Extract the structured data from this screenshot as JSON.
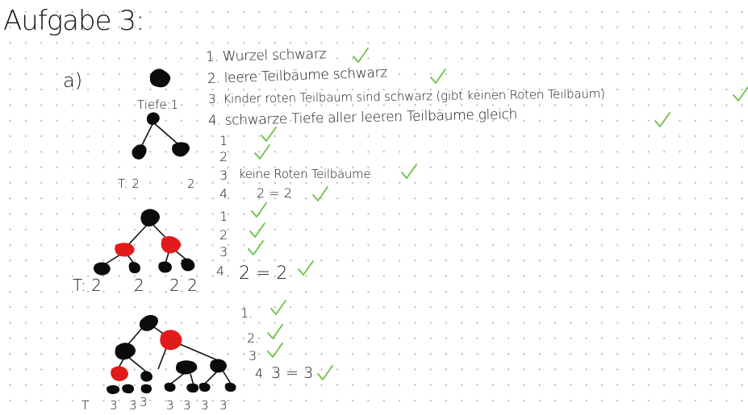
{
  "title": "Aufgabe 3:",
  "part_label": "a)",
  "tree1": {
    "depth_label": "Tiefe:1"
  },
  "tree2": {
    "t": "T: 2",
    "r": "2"
  },
  "tree3": {
    "t": "T: 2",
    "d2": "2",
    "d3": "2",
    "d4": "2"
  },
  "tree4": {
    "t": "T",
    "d": [
      "3",
      "3",
      "3",
      "3",
      "3",
      "3",
      "3"
    ]
  },
  "block1": [
    "1. Wurzel schwarz",
    "2. leere Teilbäume schwarz",
    "3. Kinder roten Teilbaum sind schwarz (gibt keinen Roten Teilbaum)",
    "4. schwarze Tiefe aller leeren Teilbäume gleich"
  ],
  "block2": {
    "n1": "1",
    "n2": "2",
    "n3": "3",
    "n4": "4",
    "t3": "keine Roten Teilbäume",
    "t4": "2 = 2"
  },
  "block3": {
    "n1": "1",
    "n2": "2",
    "n3": "3",
    "n4": "4",
    "t4": "2 = 2"
  },
  "block4": {
    "n1": "1.",
    "n2": "2.",
    "n3": "3",
    "n4": "4",
    "t4": "3 = 3"
  },
  "colors": {
    "check": "#6cc24a",
    "red_node": "#e21a1a",
    "black_node": "#0b0b0b"
  }
}
